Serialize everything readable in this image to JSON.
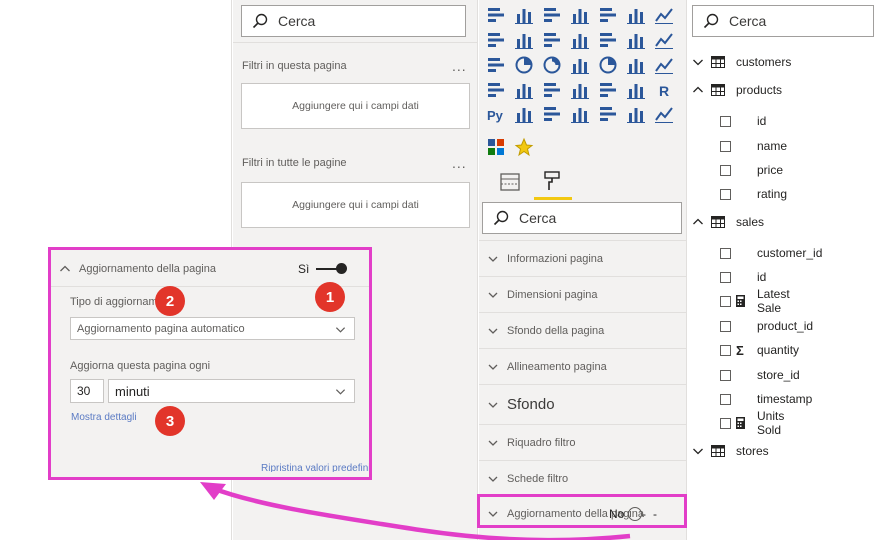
{
  "filters_pane": {
    "search_placeholder": "Cerca",
    "page_filters_title": "Filtri in questa pagina",
    "all_pages_filters_title": "Filtri in tutte le pagine",
    "more_dots": "...",
    "drop_hint": "Aggiungere qui i campi dati"
  },
  "viz_pane": {
    "icons": [
      "stacked-bar-icon",
      "stacked-column-icon",
      "clustered-bar-icon",
      "clustered-column-icon",
      "100-bar-icon",
      "100-column-icon",
      "line-chart-icon",
      "area-chart-icon",
      "stacked-area-icon",
      "line-column-icon",
      "line-clustered-column-icon",
      "ribbon-chart-icon",
      "waterfall-icon",
      "funnel-icon",
      "scatter-icon",
      "pie-icon",
      "donut-icon",
      "treemap-icon",
      "map-icon",
      "filled-map-icon",
      "shape-map-icon",
      "card-icon",
      "multi-row-card-icon",
      "kpi-icon",
      "slicer-icon",
      "table-icon",
      "matrix-icon",
      "r-visual-icon",
      "python-visual-icon",
      "key-influencers-icon",
      "decomposition-tree-icon",
      "qa-icon",
      "narrative-icon",
      "paginated-icon",
      "more-visuals-icon",
      "apps-icon",
      "custom-visual-icon"
    ],
    "r_label": "R",
    "py_label": "Py",
    "search_placeholder": "Cerca",
    "sections": [
      "Informazioni pagina",
      "Dimensioni pagina",
      "Sfondo della pagina",
      "Allineamento pagina",
      "Sfondo",
      "Riquadro filtro",
      "Schede filtro",
      "Aggiornamento della pagina"
    ],
    "toggle_label": "No",
    "toggle_trail": "-"
  },
  "fields_pane": {
    "search_placeholder": "Cerca",
    "tables": [
      {
        "name": "customers",
        "expanded": false,
        "fields": []
      },
      {
        "name": "products",
        "expanded": true,
        "fields": [
          {
            "name": "id",
            "icon": ""
          },
          {
            "name": "name",
            "icon": ""
          },
          {
            "name": "price",
            "icon": ""
          },
          {
            "name": "rating",
            "icon": ""
          }
        ]
      },
      {
        "name": "sales",
        "expanded": true,
        "fields": [
          {
            "name": "customer_id",
            "icon": ""
          },
          {
            "name": "id",
            "icon": ""
          },
          {
            "name": "Latest Sale",
            "icon": "calculator"
          },
          {
            "name": "product_id",
            "icon": ""
          },
          {
            "name": "quantity",
            "icon": "sigma"
          },
          {
            "name": "store_id",
            "icon": ""
          },
          {
            "name": "timestamp",
            "icon": ""
          },
          {
            "name": "Units Sold",
            "icon": "calculator"
          }
        ]
      },
      {
        "name": "stores",
        "expanded": false,
        "fields": []
      }
    ],
    "sigma_glyph": "Σ"
  },
  "callout": {
    "header": "Aggiornamento della pagina",
    "toggle_label": "Sì",
    "type_label": "Tipo di aggiornamento",
    "type_value": "Aggiornamento pagina automatico",
    "interval_label": "Aggiorna questa pagina ogni",
    "interval_value": "30",
    "unit_value": "minuti",
    "details_link": "Mostra dettagli",
    "reset_link": "Ripristina valori predefiniti",
    "badges": [
      "1",
      "2",
      "3"
    ]
  },
  "colors": {
    "accent_magenta": "#e23ec8",
    "badge_red": "#e2352a",
    "pane_bg": "#f3f2f1",
    "icon_blue": "#2b579a",
    "active_tab_underline": "#f2c811"
  }
}
